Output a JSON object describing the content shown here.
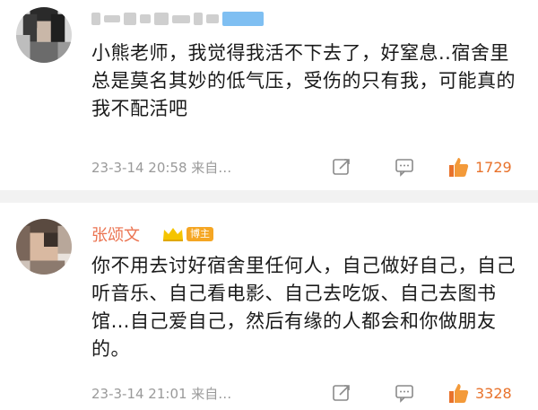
{
  "comments": [
    {
      "username_blurred": true,
      "text": "小熊老师，我觉得我活不下去了，好窒息..宿舍里总是莫名其妙的低气压，受伤的只有我，可能真的我不配活吧",
      "time": "23-3-14 20:58 来自…",
      "likes": "1729"
    },
    {
      "username": "张颂文",
      "badge": "博主",
      "text": "你不用去讨好宿舍里任何人，自己做好自己，自己听音乐、自己看电影、自己去吃饭、自己去图书馆…自己爱自己，然后有缘的人都会和你做朋友的。",
      "time": "23-3-14 21:01 来自…",
      "likes": "3328"
    }
  ],
  "icons": {
    "share": "share-icon",
    "comment": "comment-icon",
    "like": "thumbs-up-icon"
  },
  "colors": {
    "accent": "#e8722b",
    "username": "#eb7350",
    "meta": "#9a9a9a",
    "divider": "#f2f2f2",
    "badge": "#f5a623"
  }
}
